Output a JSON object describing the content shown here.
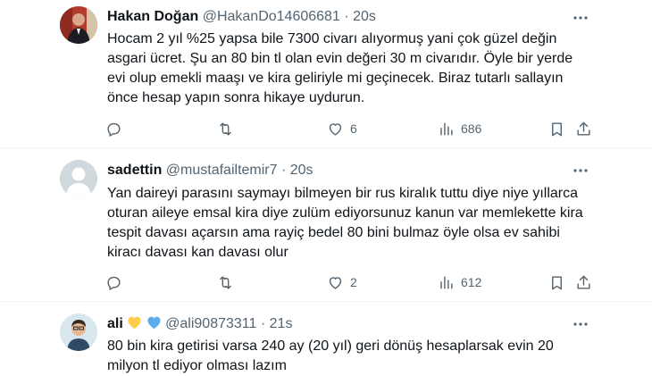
{
  "tweets": [
    {
      "name": "Hakan Doğan",
      "handle": "@HakanDo14606681",
      "separator": "·",
      "time": "20s",
      "lines": [
        "Hocam 2 yıl %25 yapsa bile 7300 civarı alıyormuş yani çok güzel değin",
        "asgari ücret. Şu an 80 bin tl olan evin değeri 30 m civarıdır. Öyle bir yerde",
        "evi olup emekli maaşı ve kira geliriyle mi geçinecek. Biraz tutarlı sallayın",
        "önce hesap yapın sonra hikaye uydurun."
      ],
      "replies": "",
      "retweets": "",
      "likes": "6",
      "views": "686"
    },
    {
      "name": "sadettin",
      "handle": "@mustafailtemir7",
      "separator": "·",
      "time": "20s",
      "lines": [
        "Yan daireyi parasını saymayı bilmeyen bir rus kiralık tuttu diye niye yıllarca",
        "oturan aileye emsal kira diye zulüm ediyorsunuz kanun var memlekette kira",
        "tespit davası açarsın ama rayiç bedel 80 bini bulmaz öyle olsa ev sahibi",
        "kiracı davası kan davası olur"
      ],
      "replies": "",
      "retweets": "",
      "likes": "2",
      "views": "612"
    },
    {
      "name": "ali",
      "handle": "@ali90873311",
      "separator": "·",
      "time": "21s",
      "name_emojis": [
        "yellow-heart",
        "blue-heart"
      ],
      "lines": [
        "80 bin kira getirisi varsa 240 ay (20 yıl) geri dönüş hesaplarsak evin 20",
        "milyon tl ediyor olması lazım"
      ]
    }
  ],
  "colors": {
    "text": "#0f1419",
    "secondary": "#536471",
    "divider": "#eff3f4",
    "yellow_heart": "#ffcc4d",
    "blue_heart": "#5dadec"
  }
}
